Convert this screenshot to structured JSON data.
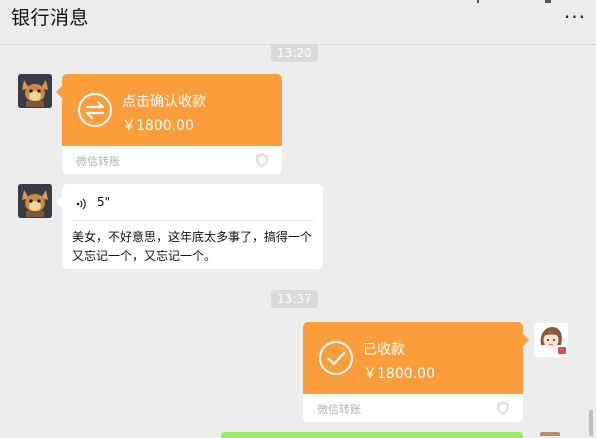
{
  "header": {
    "title": "银行消息",
    "more_label": "···"
  },
  "messages": {
    "time1": "13:20",
    "transfer1": {
      "label": "点击确认收款",
      "amount": "￥1800.00",
      "footer": "微信转账"
    },
    "voice": {
      "duration": "5\""
    },
    "text": "美女，不好意思，这年底太多事了，搞得一个又忘记一个，又忘记一个。",
    "time2": "13:37",
    "transfer2": {
      "label": "已收款",
      "amount": "￥1800.00",
      "footer": "微信转账"
    }
  },
  "colors": {
    "background": "#ededed",
    "transfer_orange": "#fb9d3b",
    "bubble_white": "#ffffff",
    "green_bubble": "#95ec69"
  }
}
